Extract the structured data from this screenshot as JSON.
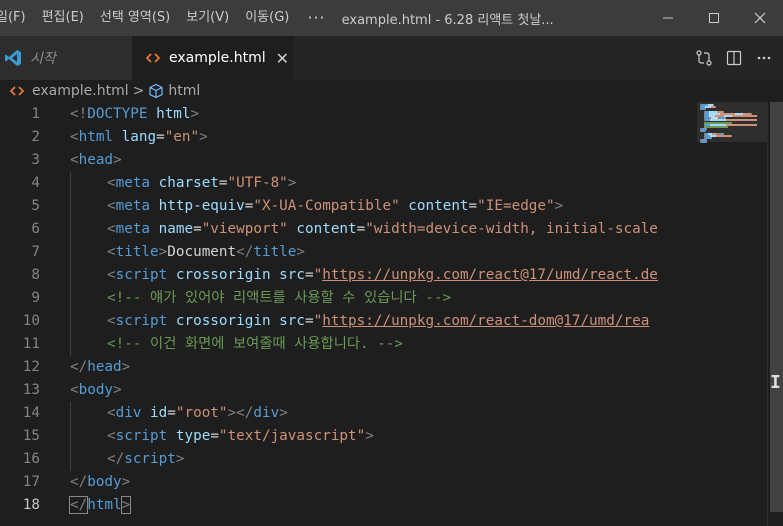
{
  "menu": {
    "items": [
      "일(F)",
      "편집(E)",
      "선택 영역(S)",
      "보기(V)",
      "이동(G)"
    ],
    "more": "···"
  },
  "window": {
    "title": "example.html - 6.28 리액트 첫날...",
    "minimize": "—",
    "maximize": "☐",
    "close": "✕"
  },
  "tabs": {
    "start_label": "시작",
    "active_label": "example.html",
    "close": "✕"
  },
  "breadcrumb": {
    "file": "example.html",
    "separator": ">",
    "symbol": "html"
  },
  "icons": {
    "vscode_logo": "vscode-logo-icon",
    "html_file": "html-file-icon",
    "compare": "open-changes-icon",
    "split": "split-editor-icon",
    "more": "more-actions-icon"
  },
  "colors": {
    "tag": "#569cd6",
    "attribute": "#9cdcfe",
    "string": "#ce9178",
    "comment": "#6a9955",
    "text": "#d4d4d4",
    "bracket": "#808080",
    "line_number": "#858585"
  },
  "editor": {
    "current_line": 18,
    "lines": [
      {
        "n": "1",
        "indent": 0,
        "tokens": [
          {
            "t": "br",
            "v": "<!"
          },
          {
            "t": "tag",
            "v": "DOCTYPE"
          },
          {
            "t": "txt",
            "v": " "
          },
          {
            "t": "attr",
            "v": "html"
          },
          {
            "t": "br",
            "v": ">"
          }
        ]
      },
      {
        "n": "2",
        "indent": 0,
        "tokens": [
          {
            "t": "br",
            "v": "<"
          },
          {
            "t": "tag",
            "v": "html"
          },
          {
            "t": "txt",
            "v": " "
          },
          {
            "t": "attr",
            "v": "lang"
          },
          {
            "t": "txt",
            "v": "="
          },
          {
            "t": "str",
            "v": "\"en\""
          },
          {
            "t": "br",
            "v": ">"
          }
        ]
      },
      {
        "n": "3",
        "indent": 0,
        "tokens": [
          {
            "t": "br",
            "v": "<"
          },
          {
            "t": "tag",
            "v": "head"
          },
          {
            "t": "br",
            "v": ">"
          }
        ]
      },
      {
        "n": "4",
        "indent": 1,
        "tokens": [
          {
            "t": "br",
            "v": "<"
          },
          {
            "t": "tag",
            "v": "meta"
          },
          {
            "t": "txt",
            "v": " "
          },
          {
            "t": "attr",
            "v": "charset"
          },
          {
            "t": "txt",
            "v": "="
          },
          {
            "t": "str",
            "v": "\"UTF-8\""
          },
          {
            "t": "br",
            "v": ">"
          }
        ]
      },
      {
        "n": "5",
        "indent": 1,
        "tokens": [
          {
            "t": "br",
            "v": "<"
          },
          {
            "t": "tag",
            "v": "meta"
          },
          {
            "t": "txt",
            "v": " "
          },
          {
            "t": "attr",
            "v": "http-equiv"
          },
          {
            "t": "txt",
            "v": "="
          },
          {
            "t": "str",
            "v": "\"X-UA-Compatible\""
          },
          {
            "t": "txt",
            "v": " "
          },
          {
            "t": "attr",
            "v": "content"
          },
          {
            "t": "txt",
            "v": "="
          },
          {
            "t": "str",
            "v": "\"IE=edge\""
          },
          {
            "t": "br",
            "v": ">"
          }
        ]
      },
      {
        "n": "6",
        "indent": 1,
        "tokens": [
          {
            "t": "br",
            "v": "<"
          },
          {
            "t": "tag",
            "v": "meta"
          },
          {
            "t": "txt",
            "v": " "
          },
          {
            "t": "attr",
            "v": "name"
          },
          {
            "t": "txt",
            "v": "="
          },
          {
            "t": "str",
            "v": "\"viewport\""
          },
          {
            "t": "txt",
            "v": " "
          },
          {
            "t": "attr",
            "v": "content"
          },
          {
            "t": "txt",
            "v": "="
          },
          {
            "t": "str",
            "v": "\"width=device-width, initial-scale"
          }
        ]
      },
      {
        "n": "7",
        "indent": 1,
        "tokens": [
          {
            "t": "br",
            "v": "<"
          },
          {
            "t": "tag",
            "v": "title"
          },
          {
            "t": "br",
            "v": ">"
          },
          {
            "t": "txt",
            "v": "Document"
          },
          {
            "t": "br",
            "v": "</"
          },
          {
            "t": "tag",
            "v": "title"
          },
          {
            "t": "br",
            "v": ">"
          }
        ]
      },
      {
        "n": "8",
        "indent": 1,
        "tokens": [
          {
            "t": "br",
            "v": "<"
          },
          {
            "t": "tag",
            "v": "script"
          },
          {
            "t": "txt",
            "v": " "
          },
          {
            "t": "attr",
            "v": "crossorigin"
          },
          {
            "t": "txt",
            "v": " "
          },
          {
            "t": "attr",
            "v": "src"
          },
          {
            "t": "txt",
            "v": "="
          },
          {
            "t": "str",
            "v": "\""
          },
          {
            "t": "url",
            "v": "https://unpkg.com/react@17/umd/react.de"
          }
        ]
      },
      {
        "n": "9",
        "indent": 1,
        "tokens": [
          {
            "t": "com",
            "v": "<!-- 얘가 있어야 리액트를 사용할 수 있습니다 -->"
          }
        ]
      },
      {
        "n": "10",
        "indent": 1,
        "tokens": [
          {
            "t": "br",
            "v": "<"
          },
          {
            "t": "tag",
            "v": "script"
          },
          {
            "t": "txt",
            "v": " "
          },
          {
            "t": "attr",
            "v": "crossorigin"
          },
          {
            "t": "txt",
            "v": " "
          },
          {
            "t": "attr",
            "v": "src"
          },
          {
            "t": "txt",
            "v": "="
          },
          {
            "t": "str",
            "v": "\""
          },
          {
            "t": "url",
            "v": "https://unpkg.com/react-dom@17/umd/rea"
          }
        ]
      },
      {
        "n": "11",
        "indent": 1,
        "tokens": [
          {
            "t": "com",
            "v": "<!-- 이건 화면에 보여줄때 사용합니다. -->"
          }
        ]
      },
      {
        "n": "12",
        "indent": 0,
        "tokens": [
          {
            "t": "br",
            "v": "</"
          },
          {
            "t": "tag",
            "v": "head"
          },
          {
            "t": "br",
            "v": ">"
          }
        ]
      },
      {
        "n": "13",
        "indent": 0,
        "tokens": [
          {
            "t": "br",
            "v": "<"
          },
          {
            "t": "tag",
            "v": "body"
          },
          {
            "t": "br",
            "v": ">"
          }
        ]
      },
      {
        "n": "14",
        "indent": 1,
        "tokens": [
          {
            "t": "br",
            "v": "<"
          },
          {
            "t": "tag",
            "v": "div"
          },
          {
            "t": "txt",
            "v": " "
          },
          {
            "t": "attr",
            "v": "id"
          },
          {
            "t": "txt",
            "v": "="
          },
          {
            "t": "str",
            "v": "\"root\""
          },
          {
            "t": "br",
            "v": "></"
          },
          {
            "t": "tag",
            "v": "div"
          },
          {
            "t": "br",
            "v": ">"
          }
        ]
      },
      {
        "n": "15",
        "indent": 1,
        "tokens": [
          {
            "t": "br",
            "v": "<"
          },
          {
            "t": "tag",
            "v": "script"
          },
          {
            "t": "txt",
            "v": " "
          },
          {
            "t": "attr",
            "v": "type"
          },
          {
            "t": "txt",
            "v": "="
          },
          {
            "t": "str",
            "v": "\"text/javascript\""
          },
          {
            "t": "br",
            "v": ">"
          }
        ]
      },
      {
        "n": "16",
        "indent": 1,
        "tokens": [
          {
            "t": "br",
            "v": "</"
          },
          {
            "t": "tag",
            "v": "script"
          },
          {
            "t": "br",
            "v": ">"
          }
        ]
      },
      {
        "n": "17",
        "indent": 0,
        "tokens": [
          {
            "t": "br",
            "v": "</"
          },
          {
            "t": "tag",
            "v": "body"
          },
          {
            "t": "br",
            "v": ">"
          }
        ]
      },
      {
        "n": "18",
        "indent": 0,
        "tokens": [
          {
            "t": "br",
            "v": "</"
          },
          {
            "t": "tag",
            "v": "html"
          },
          {
            "t": "br",
            "v": ">"
          }
        ]
      }
    ]
  }
}
